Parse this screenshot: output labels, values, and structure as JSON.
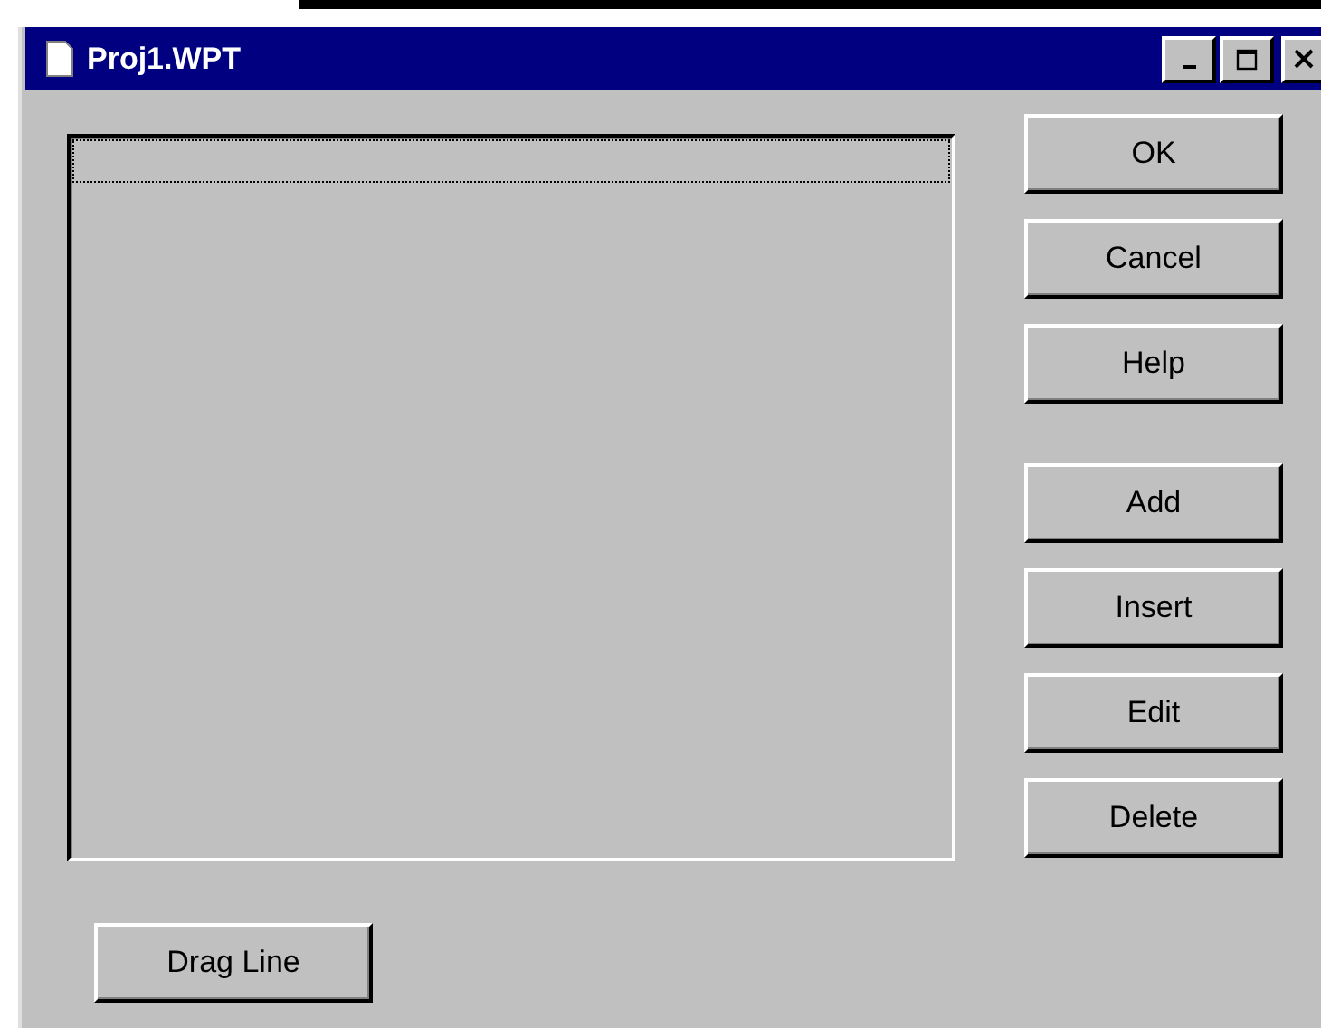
{
  "window": {
    "title": "Proj1.WPT"
  },
  "dialog_buttons": [
    "OK",
    "Cancel",
    "Help"
  ],
  "list_buttons": [
    "Add",
    "Insert",
    "Edit",
    "Delete"
  ],
  "drag_button": "Drag Line"
}
